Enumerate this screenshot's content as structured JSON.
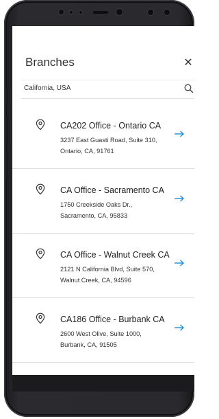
{
  "header": {
    "title": "Branches",
    "close_glyph": "✕"
  },
  "search": {
    "value": "California, USA",
    "icon": "search-icon"
  },
  "branches": [
    {
      "title": "CA202 Office - Ontario CA",
      "address_line1": "3237 East Guasti Road, Suite 310,",
      "address_line2": "Ontario, CA, 91761"
    },
    {
      "title": "CA Office - Sacramento CA",
      "address_line1": "1750 Creekside Oaks Dr.,",
      "address_line2": "Sacramento, CA, 95833"
    },
    {
      "title": "CA Office - Walnut Creek CA",
      "address_line1": "2121 N California Blvd, Suite 570,",
      "address_line2": "Walnut Creek, CA, 94596"
    },
    {
      "title": "CA186 Office - Burbank CA",
      "address_line1": "2600 West Olive, Suite 1000,",
      "address_line2": "Burbank, CA, 91505"
    }
  ],
  "colors": {
    "accent": "#1f8fd6",
    "text": "#222222",
    "divider": "#dcdcdc",
    "phone_frame": "#2a2a2e"
  }
}
